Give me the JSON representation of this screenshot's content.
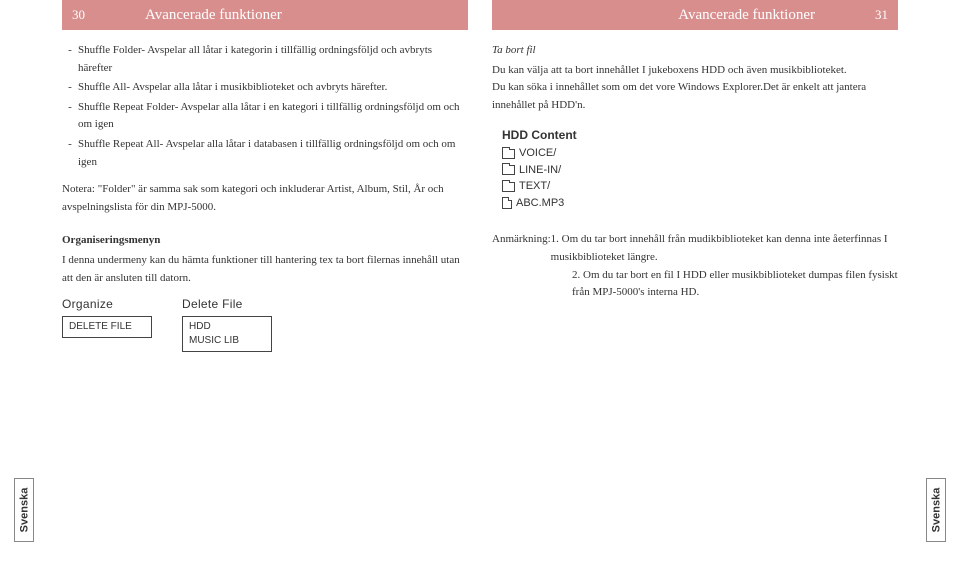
{
  "left": {
    "pageNumber": "30",
    "headerTitle": "Avancerade funktioner",
    "bullets": [
      "Shuffle Folder- Avspelar all låtar i kategorin i tillfällig ordningsföljd och avbryts härefter",
      "Shuffle All- Avspelar alla låtar i musikbiblioteket och avbryts härefter.",
      "Shuffle Repeat Folder- Avspelar alla låtar i en kategori i tillfällig ordningsföljd om och om igen",
      "Shuffle Repeat All- Avspelar alla låtar i databasen i tillfällig ordningsföljd om och om igen"
    ],
    "note": "Notera: \"Folder\" är samma sak som kategori och inkluderar Artist, Album, Stil, År och avspelningslista för din MPJ-5000.",
    "orgHeading": "Organiseringsmenyn",
    "orgText": "I denna undermeny kan du hämta funktioner till hantering tex ta bort filernas innehåll utan att den är ansluten till datorn.",
    "organizeLabel": "Organize",
    "organizeItem": "DELETE FILE",
    "deleteFileLabel": "Delete File",
    "deleteFileItems": [
      "HDD",
      "MUSIC LIB"
    ]
  },
  "right": {
    "headerTitle": "Avancerade funktioner",
    "pageNumber": "31",
    "taBortHeading": "Ta bort fil",
    "taBortLines": [
      "Du kan välja att ta bort innehållet I jukeboxens HDD och även musikbiblioteket.",
      "Du kan söka i innehållet som om det vore Windows Explorer.Det är enkelt att jantera innehållet på HDD'n."
    ],
    "hddTitle": "HDD Content",
    "hddItems": [
      {
        "icon": "folder",
        "label": "VOICE/"
      },
      {
        "icon": "folder",
        "label": "LINE-IN/"
      },
      {
        "icon": "folder",
        "label": "TEXT/"
      },
      {
        "icon": "file",
        "label": "ABC.MP3"
      }
    ],
    "annoLabel": "Anmärkning: ",
    "annotations": [
      "1. Om du tar bort innehåll från mudikbiblioteket kan denna inte åeterfinnas I musikbiblioteket längre.",
      "2. Om du tar bort en fil I HDD eller musikbiblioteket dumpas filen fysiskt från MPJ-5000's interna HD."
    ]
  },
  "sideTab": "Svenska"
}
